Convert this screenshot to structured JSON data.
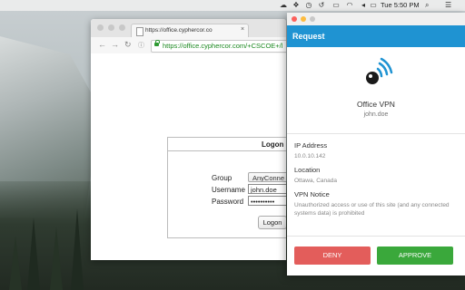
{
  "menubar": {
    "time": "Tue 5:50 PM",
    "icons": [
      "cloud-icon",
      "dropbox-icon",
      "clock-icon",
      "airplay-icon",
      "wifi-icon",
      "volume-icon",
      "battery-icon",
      "spotlight-icon",
      "notification-list-icon"
    ]
  },
  "browser": {
    "tab_title": "https://office.cyphercor.co",
    "tab_close": "×",
    "url": "https://office.cyphercor.com/+CSCOE+/l",
    "logon": {
      "title": "Logon",
      "group_label": "Group",
      "group_value": "AnyConne",
      "username_label": "Username",
      "username_value": "john.doe",
      "password_label": "Password",
      "password_value": "••••••••••",
      "button_label": "Logon"
    }
  },
  "request": {
    "title": "Request",
    "app_name": "Office VPN",
    "user": "john.doe",
    "ip_label": "IP Address",
    "ip_value": "10.0.10.142",
    "location_label": "Location",
    "location_value": "Ottawa, Canada",
    "notice_label": "VPN Notice",
    "notice_value": "Unauthorized access or use of this site (and any connected systems data) is prohibited",
    "deny_label": "DENY",
    "approve_label": "APPROVE"
  },
  "colors": {
    "header": "#1f93d2",
    "deny": "#e35d5b",
    "approve": "#3aa83b",
    "url_green": "#1d8a22"
  }
}
